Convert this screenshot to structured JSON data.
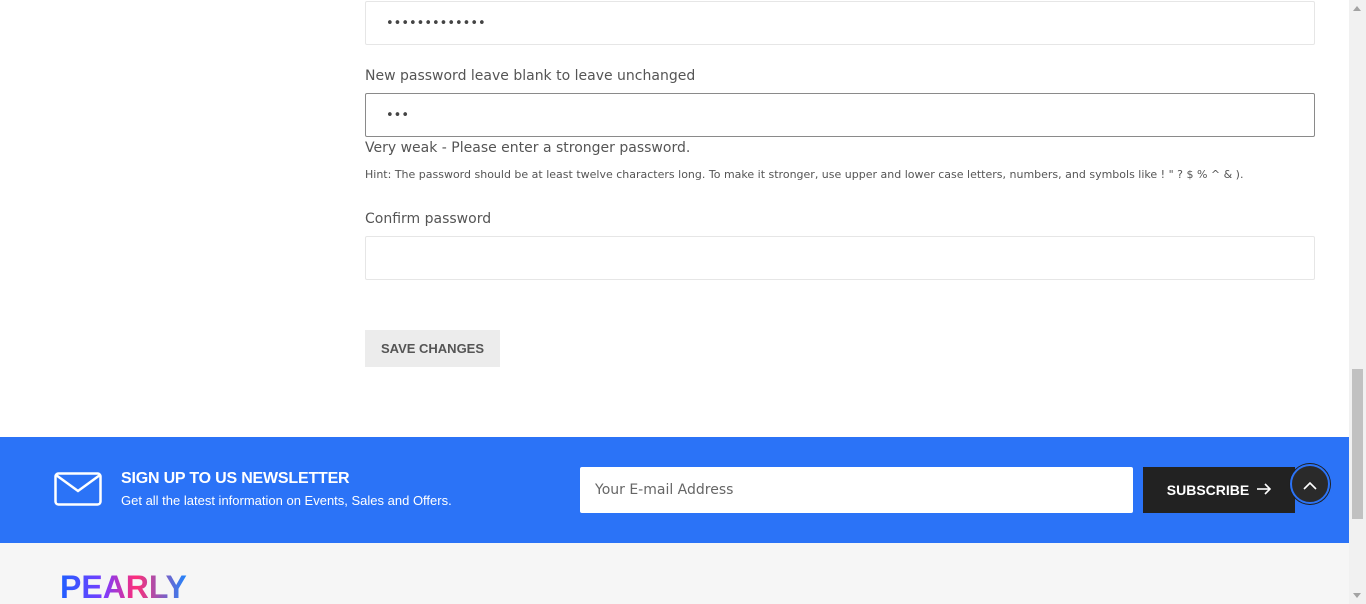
{
  "form": {
    "current_password_value": "•••••••••••••",
    "new_password_label": "New password leave blank to leave unchanged",
    "new_password_value": "•••",
    "strength_text": "Very weak - Please enter a stronger password.",
    "hint_text": "Hint: The password should be at least twelve characters long. To make it stronger, use upper and lower case letters, numbers, and symbols like ! \" ? $ % ^ & ).",
    "confirm_label": "Confirm password",
    "confirm_value": "",
    "save_label": "SAVE CHANGES"
  },
  "newsletter": {
    "icon": "envelope-icon",
    "title": "SIGN UP TO US NEWSLETTER",
    "subtitle": "Get all the latest information on Events, Sales and Offers.",
    "email_placeholder": "Your E-mail Address",
    "subscribe_label": "SUBSCRIBE",
    "background_color": "#2b73f7"
  },
  "footer": {
    "logo_text": "PEARLY"
  },
  "back_to_top": {
    "icon": "chevron-up-icon"
  }
}
